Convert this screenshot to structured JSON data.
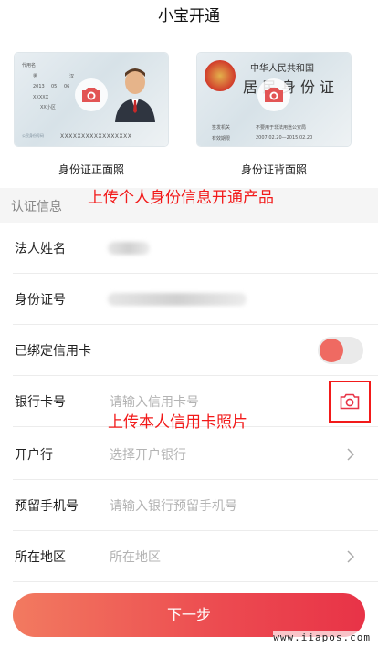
{
  "nav": {
    "title": "小宝开通"
  },
  "id_cards": {
    "front": {
      "caption": "身份证正面照",
      "lines": [
        "代用名",
        "男",
        "汉",
        "2013",
        "05",
        "06",
        "XXXXX",
        "XX小区"
      ],
      "number": "XXXXXXXXXXXXXXXXX",
      "issuer": "公民身份号码",
      "icon": "camera-icon"
    },
    "back": {
      "caption": "身份证背面照",
      "title_line1": "中华人民共和国",
      "title_line2": "居民身份证",
      "authority_label": "签发机关",
      "authority_value": "不要用于非法用途公安局",
      "validity_label": "有效期限",
      "validity_value": "2007.02.20—2015.02.20",
      "icon": "camera-icon"
    }
  },
  "annotations": {
    "upload_id": "上传个人身份信息开通产品",
    "upload_card": "上传本人信用卡照片"
  },
  "section": {
    "title": "认证信息"
  },
  "form": {
    "legal_name": {
      "label": "法人姓名"
    },
    "id_number": {
      "label": "身份证号"
    },
    "credit_card_bound": {
      "label": "已绑定信用卡",
      "state": "on"
    },
    "bank_card": {
      "label": "银行卡号",
      "placeholder": "请输入信用卡号",
      "icon": "camera-icon"
    },
    "bank": {
      "label": "开户行",
      "placeholder": "选择开户银行"
    },
    "phone": {
      "label": "预留手机号",
      "placeholder": "请输入银行预留手机号"
    },
    "region": {
      "label": "所在地区",
      "placeholder": "所在地区"
    }
  },
  "next_button": {
    "label": "下一步"
  },
  "watermark": "www.iiapos.com",
  "colors": {
    "accent": "#ec4a50",
    "annotation": "#f21a1a",
    "toggle": "#ef6a62"
  }
}
